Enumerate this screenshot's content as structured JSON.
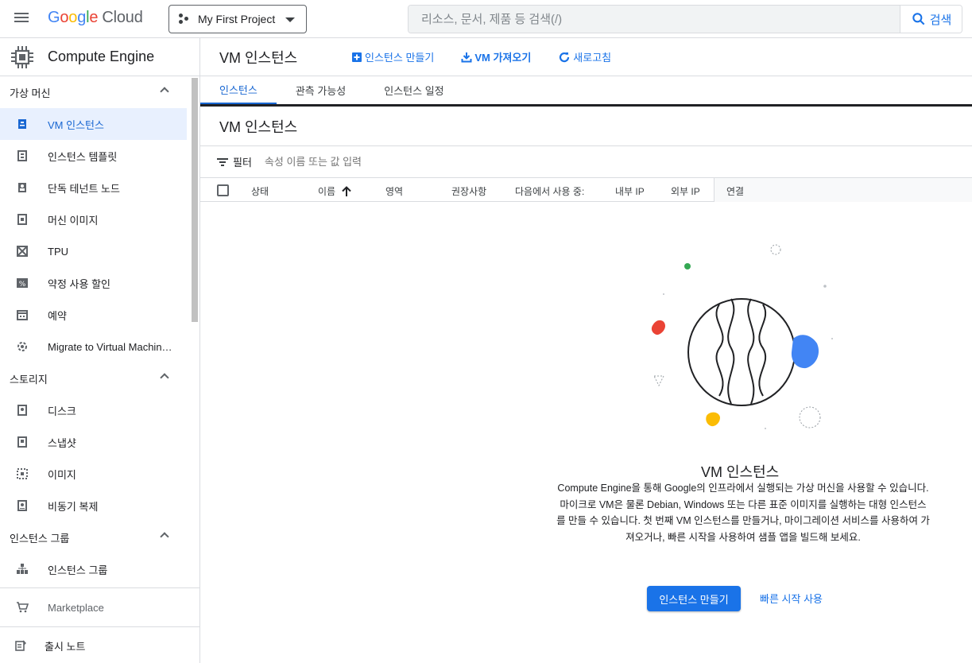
{
  "topbar": {
    "logo_g": "G",
    "logo_o1": "o",
    "logo_o2": "o",
    "logo_g2": "g",
    "logo_l": "l",
    "logo_e": "e",
    "logo_cloud": "Cloud",
    "project": "My First Project",
    "search_placeholder": "리소스, 문서, 제품 등 검색(/)",
    "search_button": "검색"
  },
  "sidebar": {
    "product": "Compute Engine",
    "sections": [
      {
        "label": "가상 머신",
        "items": [
          "VM 인스턴스",
          "인스턴스 템플릿",
          "단독 테넌트 노드",
          "머신 이미지",
          "TPU",
          "약정 사용 할인",
          "예약",
          "Migrate to Virtual Machin…"
        ]
      },
      {
        "label": "스토리지",
        "items": [
          "디스크",
          "스냅샷",
          "이미지",
          "비동기 복제"
        ]
      },
      {
        "label": "인스턴스 그룹",
        "items": [
          "인스턴스 그룹"
        ]
      }
    ],
    "marketplace": "Marketplace",
    "release_notes": "출시 노트"
  },
  "header": {
    "title": "VM 인스턴스",
    "actions": [
      "인스턴스 만들기",
      "VM 가져오기",
      "새로고침"
    ]
  },
  "tabs": [
    "인스턴스",
    "관측 가능성",
    "인스턴스 일정"
  ],
  "subtitle": "VM 인스턴스",
  "filter": {
    "label": "필터",
    "placeholder": "속성 이름 또는 값 입력"
  },
  "table": {
    "columns": [
      "상태",
      "이름",
      "영역",
      "권장사항",
      "다음에서 사용 중:",
      "내부 IP",
      "외부 IP",
      "연결"
    ],
    "sort_column": "이름"
  },
  "empty_state": {
    "title": "VM 인스턴스",
    "description": "Compute Engine을 통해 Google의 인프라에서 실행되는 가상 머신을 사용할 수 있습니다. 마이크로 VM은 물론 Debian, Windows 또는 다른 표준 이미지를 실행하는 대형 인스턴스를 만들 수 있습니다. 첫 번째 VM 인스턴스를 만들거나, 마이그레이션 서비스를 사용하여 가져오거나, 빠른 시작을 사용하여 샘플 앱을 빌드해 보세요.",
    "primary_button": "인스턴스 만들기",
    "secondary_button": "빠른 시작 사용"
  },
  "colors": {
    "accent": "#1a73e8",
    "active_bg": "#e8f0fe",
    "green": "#34a853",
    "red": "#ea4335",
    "yellow": "#fbbc04",
    "blue": "#4285f4"
  }
}
